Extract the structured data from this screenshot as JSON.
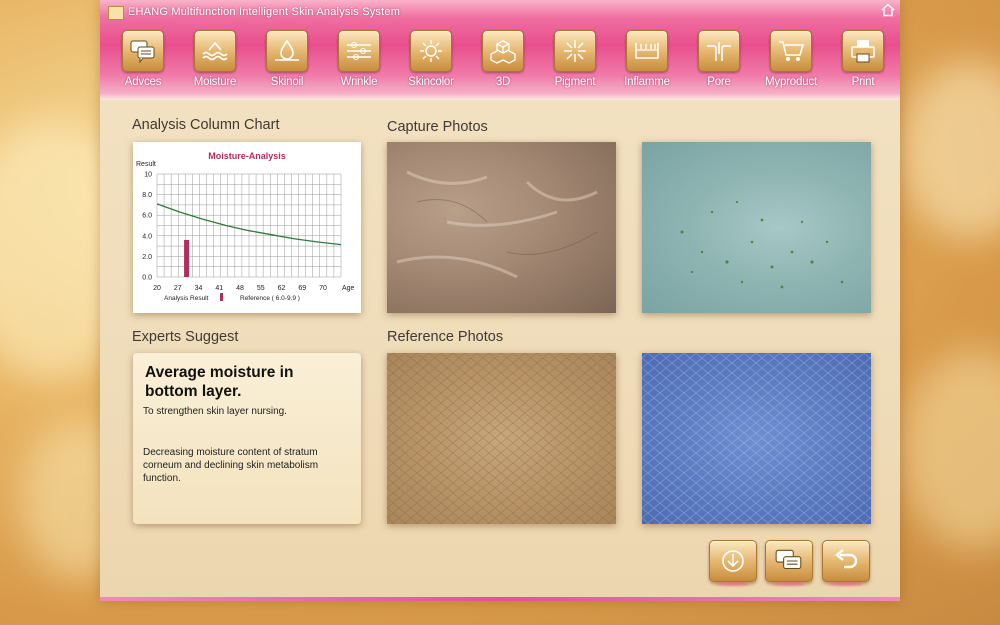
{
  "window": {
    "title": "EHANG Multifunction Intelligent Skin Analysis System"
  },
  "toolbar": [
    {
      "label": "Advces",
      "icon": "chat-bubbles-icon"
    },
    {
      "label": "Moisture",
      "icon": "water-wave-icon"
    },
    {
      "label": "Skinoil",
      "icon": "oil-drop-icon"
    },
    {
      "label": "Wrinkle",
      "icon": "wrinkle-lines-icon"
    },
    {
      "label": "Skincolor",
      "icon": "sun-icon"
    },
    {
      "label": "3D",
      "icon": "cubes-icon"
    },
    {
      "label": "Pigment",
      "icon": "sparkle-icon"
    },
    {
      "label": "Inflamme",
      "icon": "skin-layer-icon"
    },
    {
      "label": "Pore",
      "icon": "pore-icon"
    },
    {
      "label": "Myproduct",
      "icon": "cart-icon"
    },
    {
      "label": "Print",
      "icon": "printer-icon"
    }
  ],
  "sections": {
    "chart": "Analysis Column Chart",
    "capture": "Capture Photos",
    "experts": "Experts Suggest",
    "reference": "Reference Photos"
  },
  "chart_data": {
    "type": "bar",
    "title": "Moisture-Analysis",
    "ylabel": "Result",
    "xlabel": "Age",
    "x_ticks": [
      "20",
      "27",
      "34",
      "41",
      "48",
      "55",
      "62",
      "69",
      "70"
    ],
    "y_ticks": [
      "10",
      "8.0",
      "6.0",
      "4.0",
      "2.0",
      "0.0"
    ],
    "xlim": [
      20,
      76
    ],
    "ylim": [
      0,
      10
    ],
    "series": [
      {
        "name": "Analysis Result",
        "type": "bar",
        "x": 29,
        "value": 3.6,
        "color": "#b0305a"
      },
      {
        "name": "Reference ( 6.0-9.9 )",
        "type": "line",
        "color": "#2f7a3a",
        "x": [
          20,
          27,
          34,
          41,
          48,
          55,
          62,
          69,
          76
        ],
        "values": [
          7.1,
          6.3,
          5.6,
          5.0,
          4.5,
          4.1,
          3.7,
          3.4,
          3.15
        ]
      }
    ],
    "legend": {
      "result": "Analysis Result",
      "reference": "Reference ( 6.0-9.9 )"
    },
    "grid": true
  },
  "suggest": {
    "headline": "Average moisture in bottom layer.",
    "line1": "To strengthen skin layer nursing.",
    "line2": "Decreasing moisture content of stratum corneum and declining skin metabolism function."
  },
  "bottom_buttons": [
    {
      "name": "download-button",
      "icon": "down-arrow-icon"
    },
    {
      "name": "consult-button",
      "icon": "chat-bubbles-icon"
    },
    {
      "name": "back-button",
      "icon": "return-arrow-icon"
    }
  ]
}
